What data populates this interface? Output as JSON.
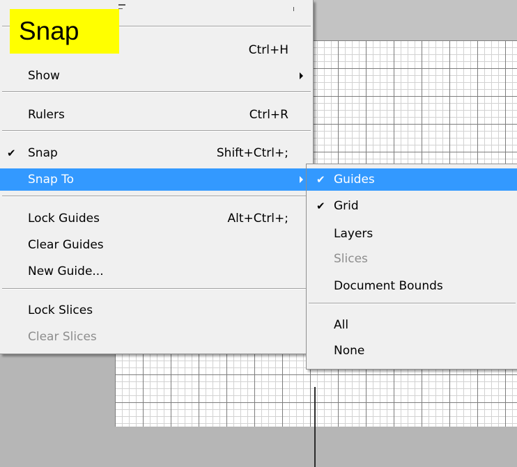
{
  "banner": {
    "text": "Snap"
  },
  "menu": {
    "items": [
      {
        "label": "",
        "shortcut": "Ctrl+H"
      },
      {
        "label": "Show",
        "submenu": true
      },
      {
        "label": "Rulers",
        "shortcut": "Ctrl+R"
      },
      {
        "label": "Snap",
        "shortcut": "Shift+Ctrl+;",
        "checked": true
      },
      {
        "label": "Snap To",
        "submenu": true,
        "highlighted": true
      },
      {
        "label": "Lock Guides",
        "shortcut": "Alt+Ctrl+;"
      },
      {
        "label": "Clear Guides"
      },
      {
        "label": "New Guide..."
      },
      {
        "label": "Lock Slices"
      },
      {
        "label": "Clear Slices",
        "disabled": true
      }
    ]
  },
  "submenu": {
    "items": [
      {
        "label": "Guides",
        "checked": true,
        "highlighted": true
      },
      {
        "label": "Grid",
        "checked": true
      },
      {
        "label": "Layers"
      },
      {
        "label": "Slices",
        "disabled": true
      },
      {
        "label": "Document Bounds"
      },
      {
        "label": "All"
      },
      {
        "label": "None"
      }
    ]
  },
  "icons": {
    "check": "✔"
  },
  "colors": {
    "highlight": "#3399ff",
    "banner": "#ffff00",
    "disabled_text": "#8d8d8d"
  }
}
